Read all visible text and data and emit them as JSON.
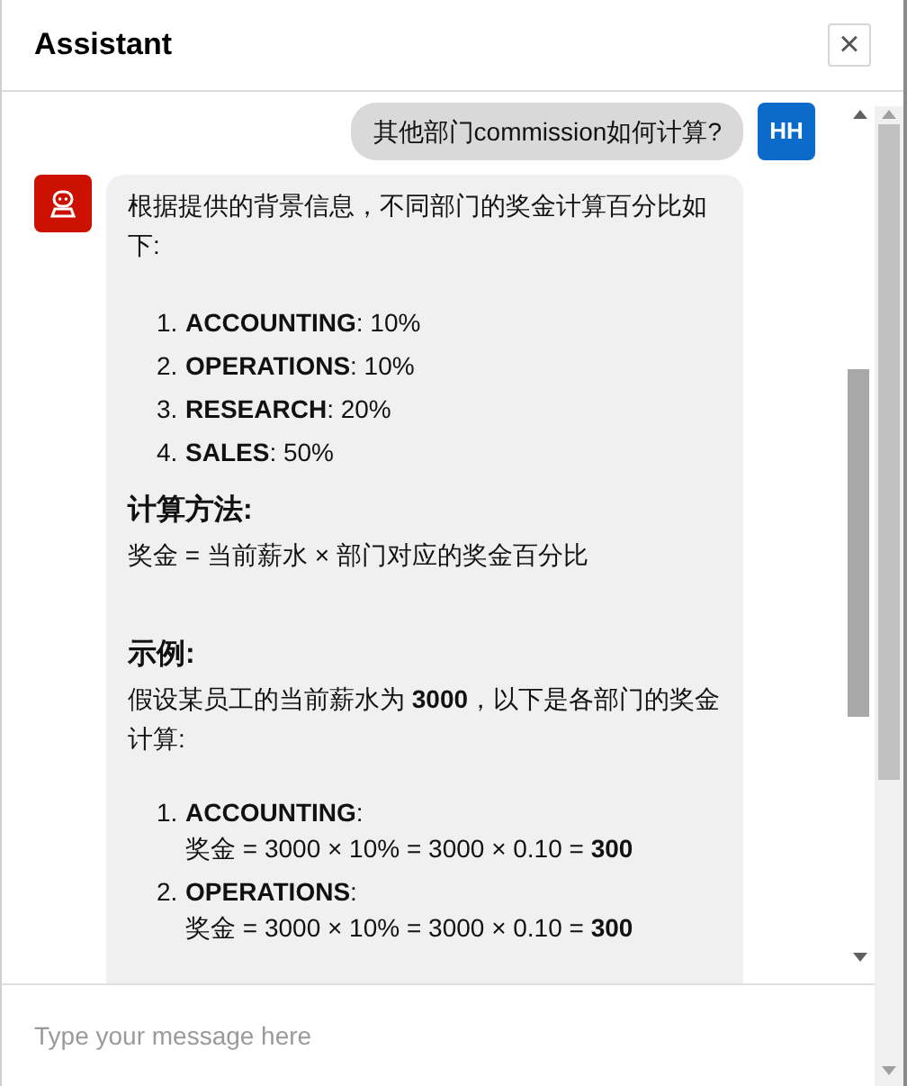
{
  "dialog": {
    "title": "Assistant",
    "close": "×"
  },
  "messages": [
    {
      "kind": "user",
      "avatar": "HH",
      "text": "其他部门commission如何计算?"
    },
    {
      "kind": "assistant",
      "blocks": [
        {
          "kind": "paragraph",
          "text": "根据提供的背景信息，不同部门的奖金计算百分比如下:"
        },
        {
          "kind": "list",
          "items": [
            {
              "number": "1.",
              "text": "**ACCOUNTING**: 10%"
            },
            {
              "number": "2.",
              "text": "**OPERATIONS**: 10%"
            },
            {
              "number": "3.",
              "text": "**RESEARCH**: 20%"
            },
            {
              "number": "4.",
              "text": "**SALES**: 50%"
            }
          ]
        },
        {
          "kind": "heading",
          "text": "计算方法:"
        },
        {
          "kind": "paragraph",
          "text": "奖金 = 当前薪水 × 部门对应的奖金百分比"
        },
        {
          "kind": "spacer"
        },
        {
          "kind": "heading",
          "text": "示例:"
        },
        {
          "kind": "paragraph",
          "text": "假设某员工的当前薪水为 **3000**，以下是各部门的奖金计算:"
        },
        {
          "kind": "list",
          "items": [
            {
              "number": "1.",
              "text": "**ACCOUNTING**:",
              "detail": "奖金 = 3000 × 10% = 3000 × 0.10 = **300**"
            },
            {
              "number": "2.",
              "text": "**OPERATIONS**:",
              "detail": "奖金 = 3000 × 10% = 3000 × 0.10 = **300**"
            }
          ]
        }
      ]
    }
  ],
  "composer": {
    "placeholder": "Type your message here"
  }
}
